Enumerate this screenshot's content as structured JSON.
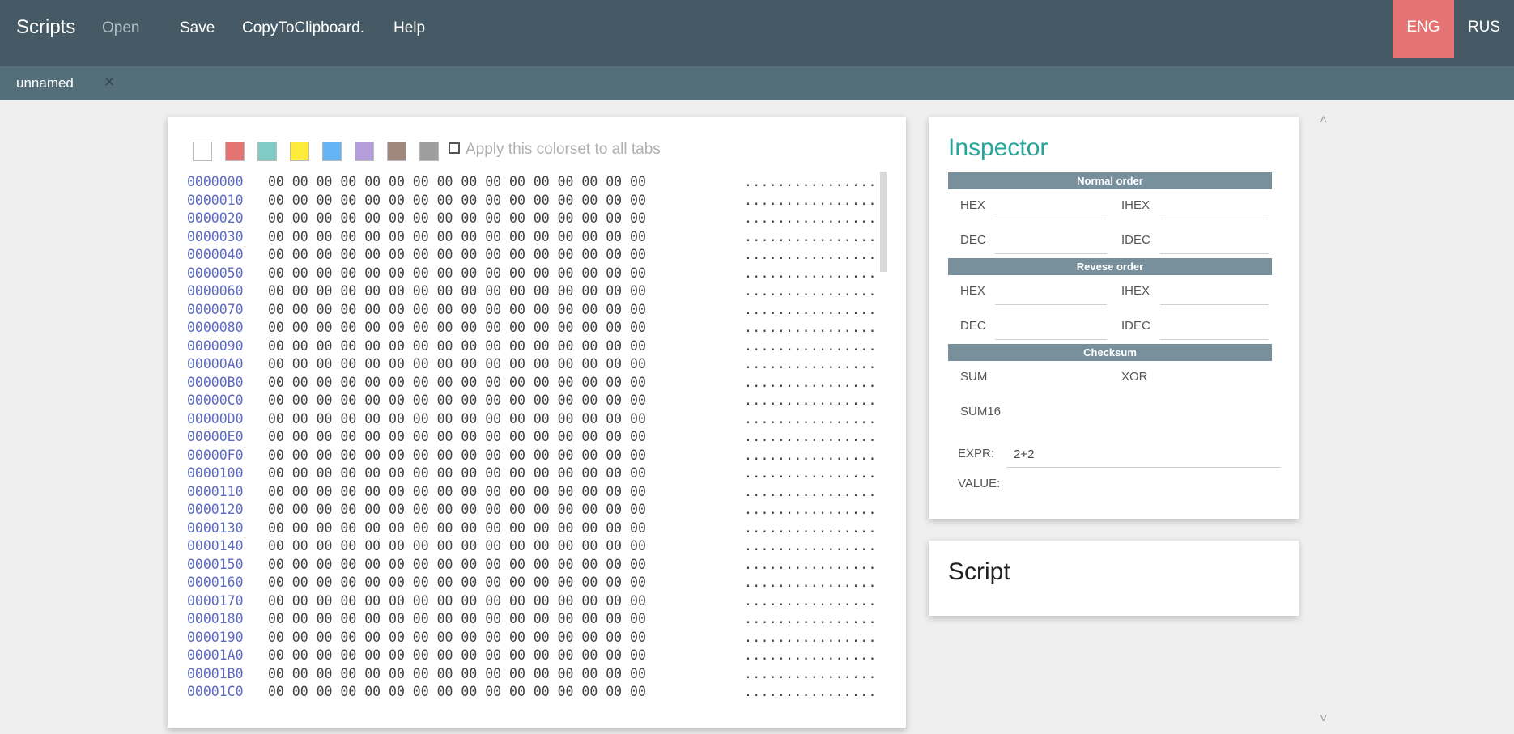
{
  "header": {
    "brand": "Scripts",
    "menu": {
      "open": "Open",
      "save": "Save",
      "copy": "CopyToClipboard.",
      "help": "Help"
    },
    "languages": {
      "eng": "ENG",
      "rus": "RUS",
      "active": "ENG",
      "active_color": "#e57373"
    }
  },
  "tabs": [
    {
      "label": "unnamed",
      "close": "✕"
    }
  ],
  "colorset": {
    "swatches": [
      "#ffffff",
      "#e57373",
      "#80cbc4",
      "#ffeb3b",
      "#64b5f6",
      "#b39ddb",
      "#a1887f",
      "#9e9e9e"
    ],
    "apply_label": "Apply this colorset to all tabs"
  },
  "hex": {
    "addresses": [
      "0000000",
      "0000010",
      "0000020",
      "0000030",
      "0000040",
      "0000050",
      "0000060",
      "0000070",
      "0000080",
      "0000090",
      "00000A0",
      "00000B0",
      "00000C0",
      "00000D0",
      "00000E0",
      "00000F0",
      "0000100",
      "0000110",
      "0000120",
      "0000130",
      "0000140",
      "0000150",
      "0000160",
      "0000170",
      "0000180",
      "0000190",
      "00001A0",
      "00001B0",
      "00001C0"
    ],
    "bytes_line": "00 00 00 00 00 00 00 00 00 00 00 00 00 00 00 00",
    "ascii_line": "................"
  },
  "inspector": {
    "title": "Inspector",
    "normal_order": "Normal order",
    "reverse_order": "Revese order",
    "checksum": "Checksum",
    "hex": "HEX",
    "ihex": "IHEX",
    "dec": "DEC",
    "idec": "IDEC",
    "sum": "SUM",
    "xor": "XOR",
    "sum16": "SUM16",
    "expr_label": "EXPR:",
    "expr_value": "2+2",
    "value_label": "VALUE:"
  },
  "script": {
    "title": "Script"
  },
  "scroll": {
    "up": "˄",
    "down": "˅"
  }
}
